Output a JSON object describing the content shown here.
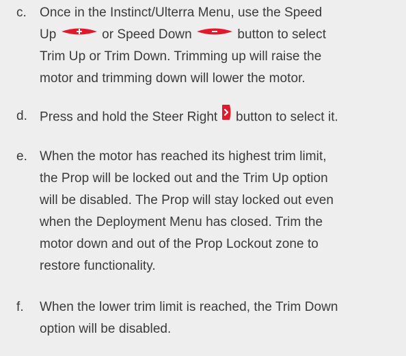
{
  "steps": [
    {
      "marker": "c.",
      "lines": [
        "Once in the Instinct/Ulterra Menu, use the Speed",
        {
          "before": "Up",
          "icon1": "speed-up-button-icon",
          "middle": "or Speed Down",
          "icon2": "speed-down-button-icon",
          "after": "button to select"
        },
        "Trim Up or Trim Down. Trimming up will raise the",
        "motor and trimming down will lower the motor."
      ]
    },
    {
      "marker": "d.",
      "before": "Press and hold the Steer Right",
      "icon": "steer-right-button-icon",
      "after": "button to select it."
    },
    {
      "marker": "e.",
      "lines": [
        "When the motor has reached its highest trim limit,",
        "the Prop will be locked out and the Trim Up option",
        "will be disabled. The Prop will stay locked out even",
        "when the Deployment Menu has closed. Trim the",
        "motor down and out of the Prop Lockout zone to",
        "restore functionality."
      ]
    },
    {
      "marker": "f.",
      "lines": [
        "When the lower trim limit is reached, the Trim Down",
        "option will be disabled."
      ]
    }
  ],
  "colors": {
    "text": "#3a3a3a",
    "background": "#eeeeee",
    "button_red": "#e0192d"
  }
}
